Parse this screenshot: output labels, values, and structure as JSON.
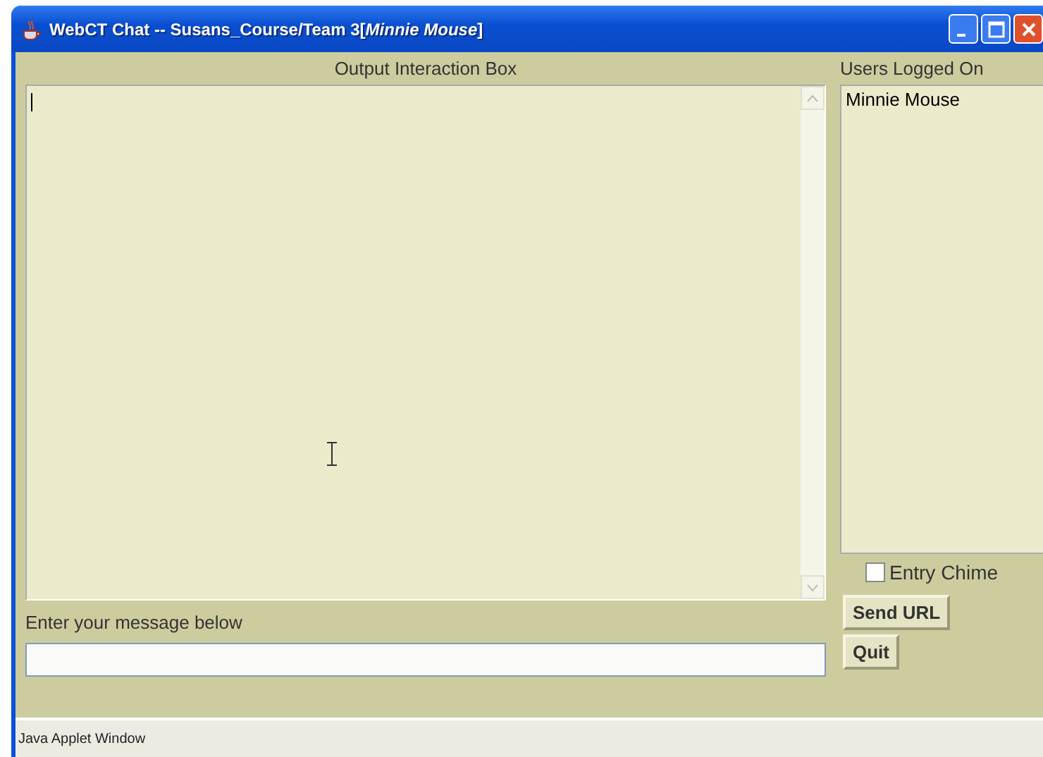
{
  "window": {
    "title": "WebCT Chat -- Susans_Course/Team 3[*Minnie Mouse*]"
  },
  "output": {
    "label": "Output Interaction Box"
  },
  "users": {
    "label": "Users Logged On",
    "items": [
      "Minnie Mouse"
    ]
  },
  "entry_chime": {
    "label": "Entry Chime",
    "checked": false
  },
  "message": {
    "label": "Enter your message below"
  },
  "buttons": [
    "Send URL",
    "Quit"
  ],
  "status_bar": "Java Applet Window"
}
